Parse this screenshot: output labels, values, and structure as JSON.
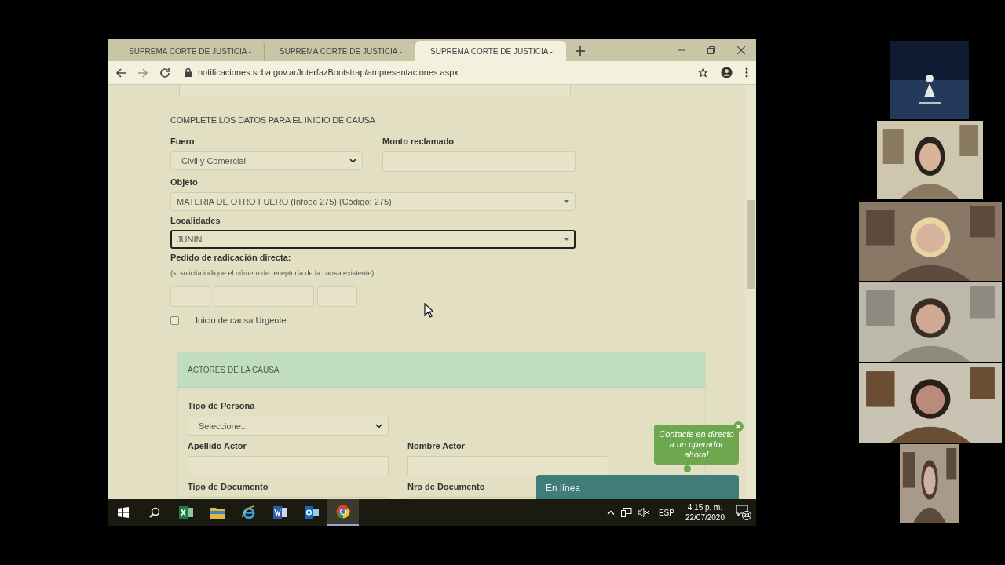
{
  "browser": {
    "tabs": [
      {
        "title": "SUPREMA CORTE DE JUSTICIA -",
        "selected": false
      },
      {
        "title": "SUPREMA CORTE DE JUSTICIA -",
        "selected": false
      },
      {
        "title": "SUPREMA CORTE DE JUSTICIA -",
        "selected": true
      }
    ],
    "url": "notificaciones.scba.gov.ar/InterfazBootstrap/ampresentaciones.aspx"
  },
  "form": {
    "heading": "COMPLETE LOS DATOS PARA EL INICIO DE CAUSA",
    "fuero": {
      "label": "Fuero",
      "value": "Civil y Comercial"
    },
    "monto": {
      "label": "Monto reclamado"
    },
    "objeto": {
      "label": "Objeto",
      "value": "MATERIA DE OTRO FUERO (Infoec 275) (Código: 275)",
      "focused": false
    },
    "localidades": {
      "label": "Localidades",
      "value": "JUNIN",
      "focused": true
    },
    "radicacion": {
      "label": "Pedido de radicación directa:",
      "hint": "(si solicita indique el número de receptoría de la causa existente)"
    },
    "urgente": {
      "label": "Inicio de causa Urgente",
      "checked": false
    }
  },
  "actores": {
    "title": "ACTORES DE LA CAUSA",
    "tipo_persona": {
      "label": "Tipo de Persona",
      "value": "Seleccione..."
    },
    "apellido": {
      "label": "Apellido Actor"
    },
    "nombre": {
      "label": "Nombre Actor"
    },
    "tipo_documento": {
      "label": "Tipo de Documento"
    },
    "nro_documento": {
      "label": "Nro de Documento"
    }
  },
  "chat": {
    "bubble": "Contacte en directo a un operador ahora!",
    "status": "En línea"
  },
  "taskbar": {
    "apps": [
      {
        "kind": "search",
        "selected": false
      },
      {
        "kind": "excel",
        "selected": false
      },
      {
        "kind": "explorer",
        "selected": false
      },
      {
        "kind": "ie",
        "selected": false
      },
      {
        "kind": "word",
        "selected": false
      },
      {
        "kind": "outlook",
        "selected": false
      },
      {
        "kind": "chrome",
        "selected": true
      }
    ],
    "language": "ESP",
    "time": "4:15 p. m.",
    "date": "22/07/2020",
    "notifications": "21"
  }
}
